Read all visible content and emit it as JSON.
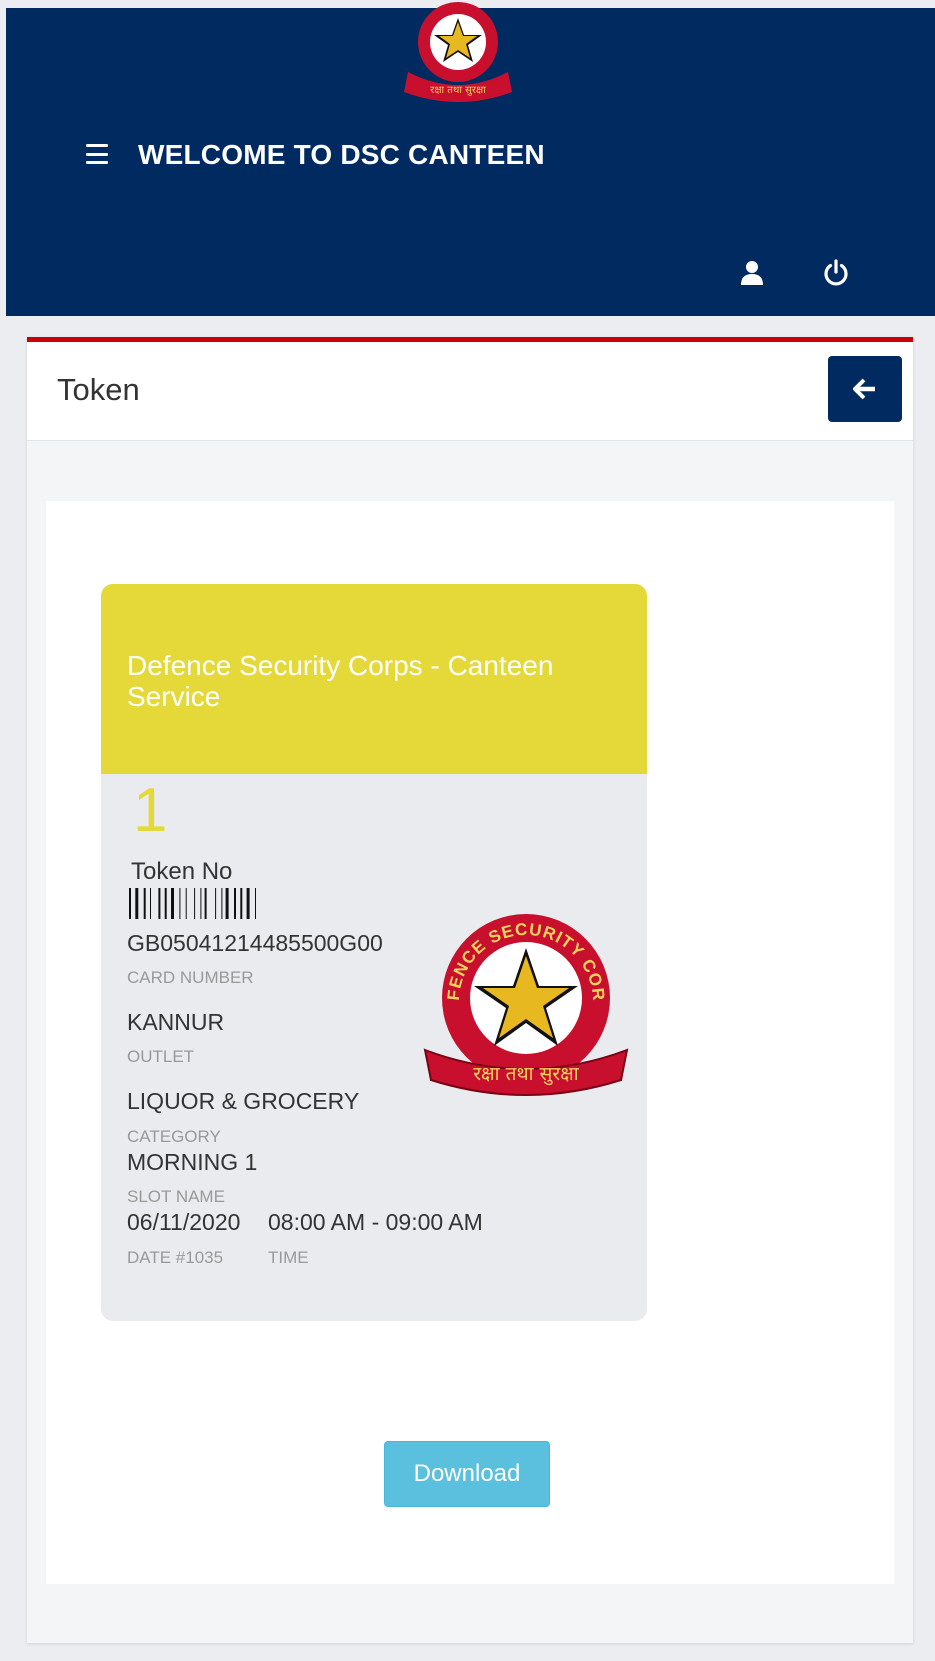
{
  "header": {
    "title": "WELCOME TO DSC CANTEEN",
    "emblem_motto": "रक्षा तथा सुरक्षा",
    "brand_color": "#002a60"
  },
  "panel": {
    "title": "Token",
    "accent_color": "#c8000a",
    "back_icon": "arrow-left-icon"
  },
  "token": {
    "organization": "Defence Security Corps - Canteen Service",
    "number": "1",
    "number_label": "Token No",
    "card_number": "GB05041214485500G00",
    "card_number_label": "CARD NUMBER",
    "outlet": "KANNUR",
    "outlet_label": "OUTLET",
    "category": "LIQUOR & GROCERY",
    "category_label": "CATEGORY",
    "slot_name": "MORNING 1",
    "slot_name_label": "SLOT NAME",
    "date": "06/11/2020",
    "date_label": "DATE #1035",
    "time": "08:00 AM - 09:00 AM",
    "time_label": "TIME",
    "emblem_text": "DEFENCE SECURITY CORPS",
    "emblem_motto": "रक्षा तथा सुरक्षा",
    "card_head_color": "#e5d93a"
  },
  "actions": {
    "download_label": "Download",
    "download_color": "#5bc0de"
  }
}
